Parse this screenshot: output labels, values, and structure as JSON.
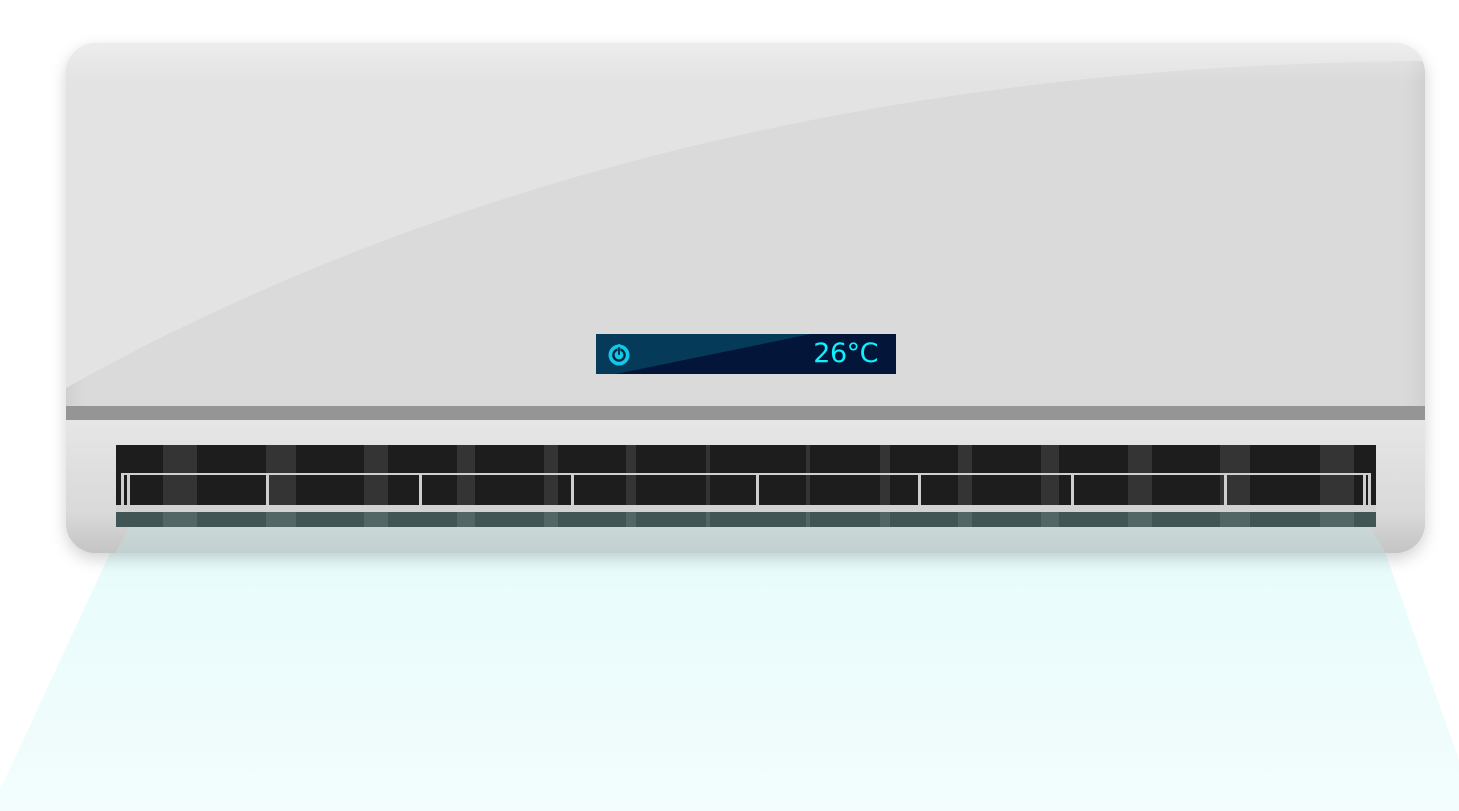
{
  "display": {
    "temperature": "26°C",
    "power_icon": "power-icon",
    "text_color": "#0ff0ff",
    "panel_color": "#03163a"
  },
  "unit": {
    "body_color": "#dadada",
    "seam_color": "#959595",
    "vent_color": "#1d1d1d"
  },
  "airflow": {
    "color": "#e8fdfd"
  }
}
